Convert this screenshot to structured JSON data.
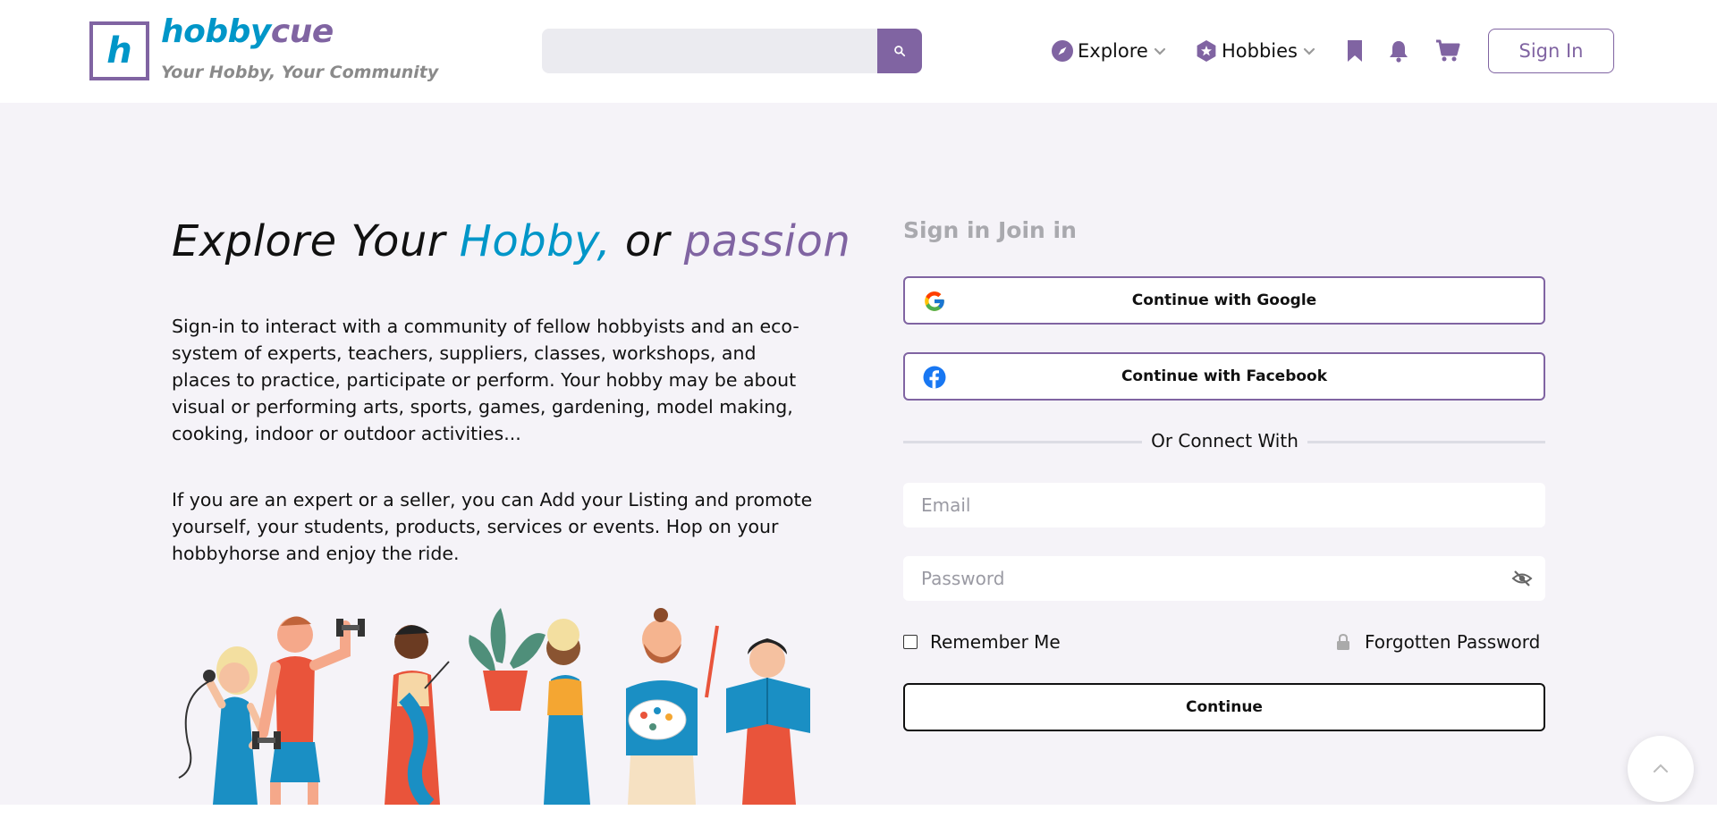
{
  "brand": {
    "logo_letter": "h",
    "name_part1": "hobby",
    "name_part2": "cue",
    "tagline": "Your Hobby, Your Community"
  },
  "search": {
    "placeholder": ""
  },
  "nav": {
    "explore_label": "Explore",
    "hobbies_label": "Hobbies",
    "signin_label": "Sign In"
  },
  "hero": {
    "title_part1": "Explore Your ",
    "title_part2": "Hobby,",
    "title_part3": " or ",
    "title_part4": "passion",
    "paragraph1": "Sign-in to interact with a community of fellow hobbyists and an eco-system of experts, teachers, suppliers, classes, workshops, and places to practice, participate or perform. Your hobby may be about visual or performing arts, sports, games, gardening, model making, cooking, indoor or outdoor activities...",
    "paragraph2": "If you are an expert or a seller, you can Add your Listing and promote yourself, your students, products, services or events. Hop on your hobbyhorse and enjoy the ride."
  },
  "auth": {
    "tab_signin": "Sign in",
    "tab_join": "Join in",
    "google_label": "Continue with Google",
    "facebook_label": "Continue with Facebook",
    "divider_text": "Or Connect With",
    "email_placeholder": "Email",
    "password_placeholder": "Password",
    "remember_label": "Remember Me",
    "forgot_label": "Forgotten Password",
    "continue_label": "Continue"
  },
  "colors": {
    "brand_purple": "#8064a2",
    "brand_blue": "#0096c8",
    "page_bg": "#f5f3f8"
  }
}
